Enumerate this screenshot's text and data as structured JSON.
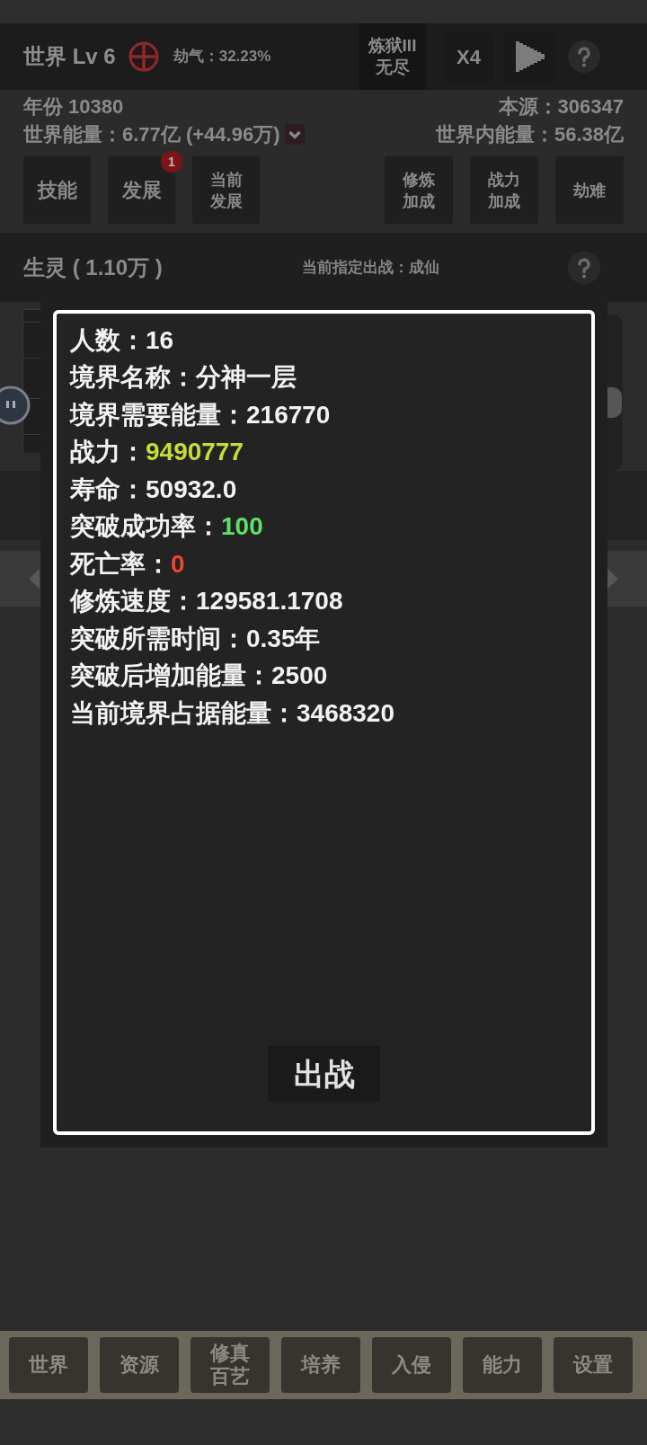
{
  "header": {
    "title": "世界 Lv 6",
    "calamity": "劫气：32.23%",
    "mode": "炼狱III\n无尽",
    "speed": "X4"
  },
  "stats": {
    "year": "年份 10380",
    "source": "本源：306347",
    "world_energy": "世界能量：6.77亿 (+44.96万)",
    "inner_energy": "世界内能量：56.38亿"
  },
  "actions_left": [
    {
      "label": "技能"
    },
    {
      "label": "发展",
      "badge": "1"
    },
    {
      "label": "当前发展"
    }
  ],
  "actions_right": [
    {
      "label": "修炼加成"
    },
    {
      "label": "战力加成"
    },
    {
      "label": "劫难"
    }
  ],
  "population": {
    "title": "生灵 ( 1.10万 )",
    "assigned": "当前指定出战：成仙"
  },
  "dialog": {
    "stats": [
      {
        "label": "人数：",
        "value": "16",
        "color": "#f2f2f2"
      },
      {
        "label": "境界名称：",
        "value": "分神一层",
        "color": "#f2f2f2"
      },
      {
        "label": "境界需要能量：",
        "value": "216770",
        "color": "#f2f2f2"
      },
      {
        "label": "战力：",
        "value": "9490777",
        "color": "#c6dc3a"
      },
      {
        "label": "寿命：",
        "value": "50932.0",
        "color": "#f2f2f2"
      },
      {
        "label": "突破成功率：",
        "value": "100",
        "color": "#5fe06a"
      },
      {
        "label": "死亡率：",
        "value": "0",
        "color": "#ee4433"
      },
      {
        "label": "修炼速度：",
        "value": "129581.1708",
        "color": "#f2f2f2"
      },
      {
        "label": "突破所需时间：",
        "value": "0.35年",
        "color": "#f2f2f2"
      },
      {
        "label": "突破后增加能量：",
        "value": "2500",
        "color": "#f2f2f2"
      },
      {
        "label": "当前境界占据能量：",
        "value": "3468320",
        "color": "#f2f2f2"
      }
    ],
    "button": "出战"
  },
  "nav": [
    {
      "label": "世界"
    },
    {
      "label": "资源"
    },
    {
      "label": "修真百艺"
    },
    {
      "label": "培养"
    },
    {
      "label": "入侵"
    },
    {
      "label": "能力"
    },
    {
      "label": "设置"
    }
  ]
}
